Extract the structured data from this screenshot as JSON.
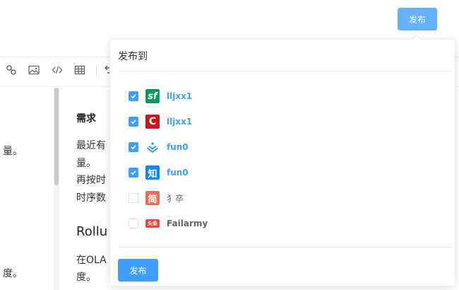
{
  "header": {
    "publish_label": "发布"
  },
  "toolbar": {
    "icons": [
      "link-icon",
      "image-icon",
      "code-icon",
      "table-icon",
      "undo-icon"
    ]
  },
  "editor": {
    "left_fragments": [
      "量。",
      "度。"
    ],
    "preview": {
      "heading": "需求",
      "lines": [
        "最近有",
        "量。",
        "再按时",
        "时序数"
      ],
      "heading2": "Rollu",
      "lines2": [
        "在OLA",
        "度。"
      ]
    }
  },
  "popover": {
    "title": "发布到",
    "items": [
      {
        "name": "lljxx1",
        "checked": true,
        "logo_text": "sf",
        "logo_color": "#009a61"
      },
      {
        "name": "lljxx1",
        "checked": true,
        "logo_text": "C",
        "logo_color": "#c9171e"
      },
      {
        "name": "fun0",
        "checked": true,
        "logo_text": "",
        "logo_color": "#2e8cef"
      },
      {
        "name": "fun0",
        "checked": true,
        "logo_text": "知",
        "logo_color": "#0f88eb"
      },
      {
        "name": "犭卒",
        "checked": false,
        "logo_text": "简",
        "logo_color": "#ea6f5a"
      },
      {
        "name": "Failarmy",
        "checked": false,
        "logo_text": "头条",
        "logo_color": "#f04142"
      }
    ],
    "submit_label": "发布"
  },
  "colors": {
    "accent": "#409eff",
    "accent_light": "#66b1ff"
  }
}
